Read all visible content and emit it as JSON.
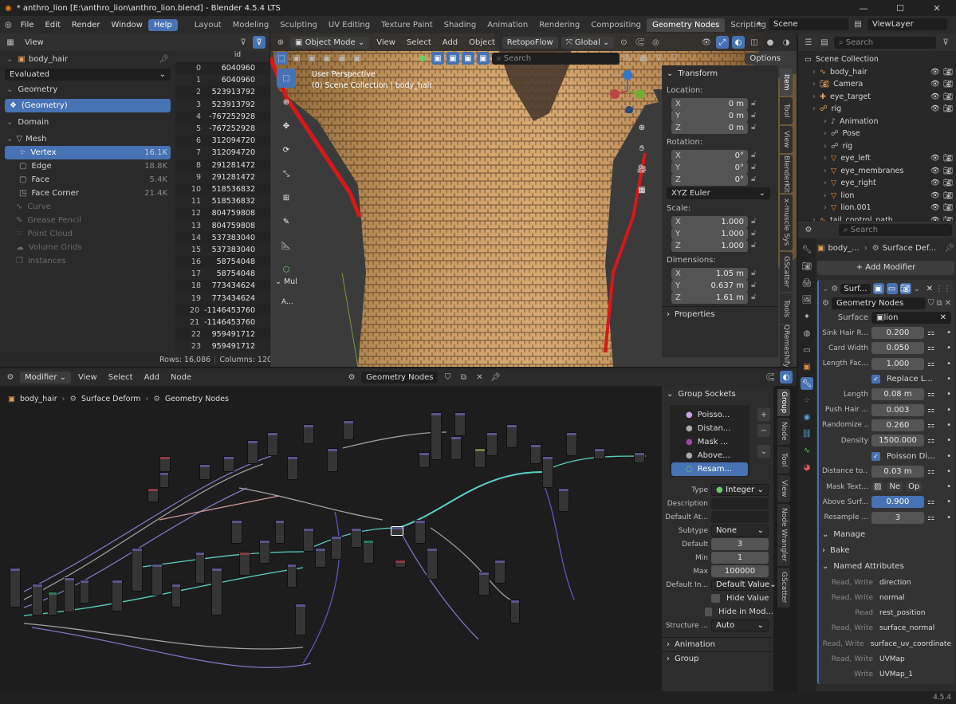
{
  "window": {
    "title": "* anthro_lion [E:\\anthro_lion\\anthro_lion.blend] - Blender 4.5.4 LTS",
    "minimize": "—",
    "maximize": "☐",
    "close": "✕"
  },
  "menu": [
    "File",
    "Edit",
    "Render",
    "Window",
    "Help"
  ],
  "workspaces": [
    "Layout",
    "Modeling",
    "Sculpting",
    "UV Editing",
    "Texture Paint",
    "Shading",
    "Animation",
    "Rendering",
    "Compositing",
    "Geometry Nodes",
    "Scripting"
  ],
  "topbar_right": {
    "scene": "Scene",
    "view_layer": "ViewLayer"
  },
  "spreadsheet": {
    "header_view": "View",
    "object": "body_hair",
    "evaluated": "Evaluated",
    "geometry_label": "Geometry",
    "geometry_item": "(Geometry)",
    "domain_label": "Domain",
    "mesh_label": "Mesh",
    "domains": [
      {
        "name": "Vertex",
        "count": "16.1K"
      },
      {
        "name": "Edge",
        "count": "18.8K"
      },
      {
        "name": "Face",
        "count": "5.4K"
      },
      {
        "name": "Face Corner",
        "count": "21.4K"
      }
    ],
    "other_components": [
      "Curve",
      "Grease Pencil",
      "Point Cloud",
      "Volume Grids",
      "Instances"
    ],
    "column_header": "id",
    "rows": [
      [
        "0",
        "6040960"
      ],
      [
        "1",
        "6040960"
      ],
      [
        "2",
        "523913792"
      ],
      [
        "3",
        "523913792"
      ],
      [
        "4",
        "-767252928"
      ],
      [
        "5",
        "-767252928"
      ],
      [
        "6",
        "312094720"
      ],
      [
        "7",
        "312094720"
      ],
      [
        "8",
        "291281472"
      ],
      [
        "9",
        "291281472"
      ],
      [
        "10",
        "518536832"
      ],
      [
        "11",
        "518536832"
      ],
      [
        "12",
        "804759808"
      ],
      [
        "13",
        "804759808"
      ],
      [
        "14",
        "537383040"
      ],
      [
        "15",
        "537383040"
      ],
      [
        "16",
        "58754048"
      ],
      [
        "17",
        "58754048"
      ],
      [
        "18",
        "773434624"
      ],
      [
        "19",
        "773434624"
      ],
      [
        "20",
        "-1146453760"
      ],
      [
        "21",
        "-1146453760"
      ],
      [
        "22",
        "959491712"
      ],
      [
        "23",
        "959491712"
      ]
    ],
    "footer_rows": "Rows: 16,086",
    "footer_cols": "Columns: 120"
  },
  "viewport": {
    "mode": "Object Mode",
    "menu": [
      "View",
      "Select",
      "Add",
      "Object"
    ],
    "retopoflow": "RetopoFlow",
    "orientation": "Global",
    "search_placeholder": "Search",
    "options": "Options",
    "overlay_title": "User Perspective",
    "overlay_sub": "(0) Scene Collection | body_hair",
    "mul_label": "Mul",
    "a_label": "A...",
    "transform": {
      "title": "Transform",
      "location_label": "Location:",
      "location": [
        [
          "X",
          "0 m"
        ],
        [
          "Y",
          "0 m"
        ],
        [
          "Z",
          "0 m"
        ]
      ],
      "rotation_label": "Rotation:",
      "rotation": [
        [
          "X",
          "0°"
        ],
        [
          "Y",
          "0°"
        ],
        [
          "Z",
          "0°"
        ]
      ],
      "euler": "XYZ Euler",
      "scale_label": "Scale:",
      "scale": [
        [
          "X",
          "1.000"
        ],
        [
          "Y",
          "1.000"
        ],
        [
          "Z",
          "1.000"
        ]
      ],
      "dimensions_label": "Dimensions:",
      "dimensions": [
        [
          "X",
          "1.05 m"
        ],
        [
          "Y",
          "0.637 m"
        ],
        [
          "Z",
          "1.61 m"
        ]
      ],
      "properties": "Properties"
    },
    "side_tabs": [
      "Item",
      "Tool",
      "View",
      "BlenderKit",
      "x-muscle Sys",
      "GScatter",
      "Tools",
      "QRemeshify"
    ]
  },
  "outliner": {
    "search_placeholder": "Search",
    "root": "Scene Collection",
    "items": [
      {
        "name": "body_hair",
        "indent": 1
      },
      {
        "name": "Camera",
        "indent": 1
      },
      {
        "name": "eye_target",
        "indent": 1
      },
      {
        "name": "rig",
        "indent": 1
      },
      {
        "name": "Animation",
        "indent": 2
      },
      {
        "name": "Pose",
        "indent": 2
      },
      {
        "name": "rig",
        "indent": 2
      },
      {
        "name": "eye_left",
        "indent": 2
      },
      {
        "name": "eye_membranes",
        "indent": 2
      },
      {
        "name": "eye_right",
        "indent": 2
      },
      {
        "name": "lion",
        "indent": 2
      },
      {
        "name": "lion.001",
        "indent": 2
      },
      {
        "name": "tail_control_path",
        "indent": 1
      }
    ]
  },
  "properties": {
    "search_placeholder": "Search",
    "breadcrumb_object": "body_...",
    "breadcrumb_modifier": "Surface Def...",
    "add_modifier": "Add Modifier",
    "modifier_name": "Surf...",
    "node_group": "Geometry Nodes",
    "surface_label": "Surface",
    "surface_value": "lion",
    "params": [
      {
        "label": "Sink Hair R...",
        "value": "0.200",
        "type": "num"
      },
      {
        "label": "Card Width",
        "value": "0.050",
        "type": "num"
      },
      {
        "label": "Length Fac...",
        "value": "1.000",
        "type": "num"
      },
      {
        "label": "Replace L...",
        "value": "",
        "type": "check"
      },
      {
        "label": "Length",
        "value": "0.08 m",
        "type": "num"
      },
      {
        "label": "Push Hair ...",
        "value": "0.003",
        "type": "num"
      },
      {
        "label": "Randomize ...",
        "value": "0.260",
        "type": "num"
      },
      {
        "label": "Density",
        "value": "1500.000",
        "type": "num"
      },
      {
        "label": "Poisson Di...",
        "value": "",
        "type": "check"
      },
      {
        "label": "Distance to...",
        "value": "0.03 m",
        "type": "num"
      },
      {
        "label": "Mask Text...",
        "value": "",
        "type": "tex"
      },
      {
        "label": "Above Surf...",
        "value": "0.900",
        "type": "blue"
      },
      {
        "label": "Resample ...",
        "value": "3",
        "type": "num"
      }
    ],
    "tex_new": "Ne",
    "tex_open": "Op",
    "manage": "Manage",
    "bake": "Bake",
    "named_attributes": "Named Attributes",
    "attributes": [
      {
        "mode": "Read, Write",
        "name": "direction"
      },
      {
        "mode": "Read, Write",
        "name": "normal"
      },
      {
        "mode": "Read",
        "name": "rest_position"
      },
      {
        "mode": "Read, Write",
        "name": "surface_normal"
      },
      {
        "mode": "Read, Write",
        "name": "surface_uv_coordinate"
      },
      {
        "mode": "Read, Write",
        "name": "UVMap"
      },
      {
        "mode": "Write",
        "name": "UVMap_1"
      }
    ]
  },
  "node_editor": {
    "header_mode": "Modifier",
    "menu": [
      "View",
      "Select",
      "Add",
      "Node"
    ],
    "tree_name": "Geometry Nodes",
    "breadcrumb": [
      "body_hair",
      "Surface Deform",
      "Geometry Nodes"
    ],
    "side_tabs": [
      "Group",
      "Node",
      "Tool",
      "View",
      "Node Wrangler",
      "GScatter"
    ],
    "group_sockets": {
      "title": "Group Sockets",
      "items": [
        "Poisso...",
        "Distan...",
        "Mask ...",
        "Above...",
        "Resam..."
      ],
      "type_label": "Type",
      "type_value": "Integer",
      "description_label": "Description",
      "default_attr_label": "Default At...",
      "subtype_label": "Subtype",
      "subtype_value": "None",
      "default_label": "Default",
      "default_value": "3",
      "min_label": "Min",
      "min_value": "1",
      "max_label": "Max",
      "max_value": "100000",
      "default_input_label": "Default In...",
      "default_input_value": "Default Value",
      "hide_value": "Hide Value",
      "hide_modifier": "Hide in Mod...",
      "structure_label": "Structure ...",
      "structure_value": "Auto",
      "animation": "Animation",
      "group": "Group"
    }
  },
  "status": {
    "version": "4.5.4"
  },
  "colors": {
    "accent": "#4772b3",
    "panel": "#303030",
    "bg": "#1d1d1d"
  }
}
